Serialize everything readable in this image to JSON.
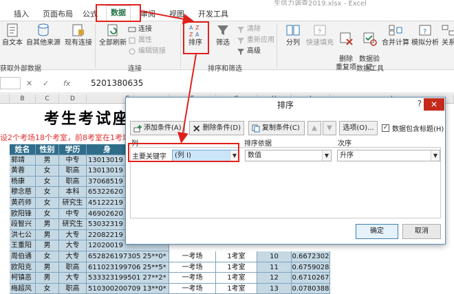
{
  "window": {
    "title_fragment": "生信力调查2019.xlsx - Excel"
  },
  "tabs": [
    "插入",
    "页面布局",
    "公式",
    "数据",
    "审阅",
    "视图",
    "开发工具"
  ],
  "active_tab": "数据",
  "ribbon": {
    "ext_data": {
      "from_text": "自文本",
      "from_other": "自其他来源",
      "existing": "现有连接",
      "label": "获取外部数据"
    },
    "connections": {
      "refresh_all": "全部刷新",
      "connect": "连接",
      "properties": "属性",
      "edit_links": "编辑链接",
      "label": "连接"
    },
    "sort_filter": {
      "sort": "排序",
      "filter": "筛选",
      "clear": "清除",
      "reapply": "重新应用",
      "advanced": "高级",
      "label": "排序和筛选"
    },
    "data_tools": {
      "split": "分列",
      "flash_fill": "快速填充",
      "remove_dup": "删除\n重复项",
      "validation": "数据验\n证",
      "consolidate": "合并计算",
      "what_if": "模拟分析",
      "relation": "关系",
      "label": "数据工具"
    }
  },
  "formula_bar": {
    "fx": "fx",
    "value": "5201380635"
  },
  "sheet": {
    "columns": [
      "B",
      "C",
      "D",
      "E",
      "F",
      "G",
      "H",
      "I",
      "J"
    ],
    "title": "考生考试座",
    "notice": "设2个考场18个考室，前8考室在1考场，后",
    "headers": [
      "姓名",
      "性别",
      "学历",
      "身"
    ],
    "rows": [
      {
        "name": "郭靖",
        "sex": "男",
        "edu": "中专",
        "id": "13013019"
      },
      {
        "name": "黄蓉",
        "sex": "女",
        "edu": "职高",
        "id": "13013019"
      },
      {
        "name": "杨康",
        "sex": "女",
        "edu": "职高",
        "id": "37068519"
      },
      {
        "name": "穆念慈",
        "sex": "女",
        "edu": "本科",
        "id": "65322620"
      },
      {
        "name": "黄药师",
        "sex": "女",
        "edu": "研究生",
        "id": "45122219"
      },
      {
        "name": "欧阳锋",
        "sex": "女",
        "edu": "中专",
        "id": "46902620"
      },
      {
        "name": "段智兴",
        "sex": "男",
        "edu": "研究生",
        "id": "53032319"
      },
      {
        "name": "洪七公",
        "sex": "男",
        "edu": "大专",
        "id": "22082219"
      },
      {
        "name": "王重阳",
        "sex": "男",
        "edu": "大专",
        "id": "12020019"
      },
      {
        "name": "周伯通",
        "sex": "女",
        "edu": "大专",
        "id": "652826197305 25**0*",
        "site": "一考场",
        "room": "1考室",
        "no": "10",
        "rand": "0.6672302"
      },
      {
        "name": "欧阳克",
        "sex": "男",
        "edu": "职高",
        "id": "611023199706 25**5*",
        "site": "一考场",
        "room": "1考室",
        "no": "11",
        "rand": "0.6759028"
      },
      {
        "name": "柯镇恶",
        "sex": "男",
        "edu": "大专",
        "id": "533323199501 27**2*",
        "site": "一考场",
        "room": "1考室",
        "no": "12",
        "rand": "0.6710267"
      },
      {
        "name": "梅超风",
        "sex": "女",
        "edu": "职高",
        "id": "510300200709 13**0*",
        "site": "一考场",
        "room": "1考室",
        "no": "13",
        "rand": "0.0780388"
      }
    ]
  },
  "dialog": {
    "title": "排序",
    "help": "?",
    "close": "✕",
    "add_level": "添加条件(A)",
    "delete_level": "删除条件(D)",
    "copy_level": "复制条件(C)",
    "options": "选项(O)...",
    "header_checkbox": "数据包含标题(H)",
    "col_header": "列",
    "sorton_header": "排序依据",
    "order_header": "次序",
    "row_label": "主要关键字",
    "column_value": "(列 I)",
    "sorton_value": "数值",
    "order_value": "升序",
    "ok": "确定",
    "cancel": "取消"
  }
}
